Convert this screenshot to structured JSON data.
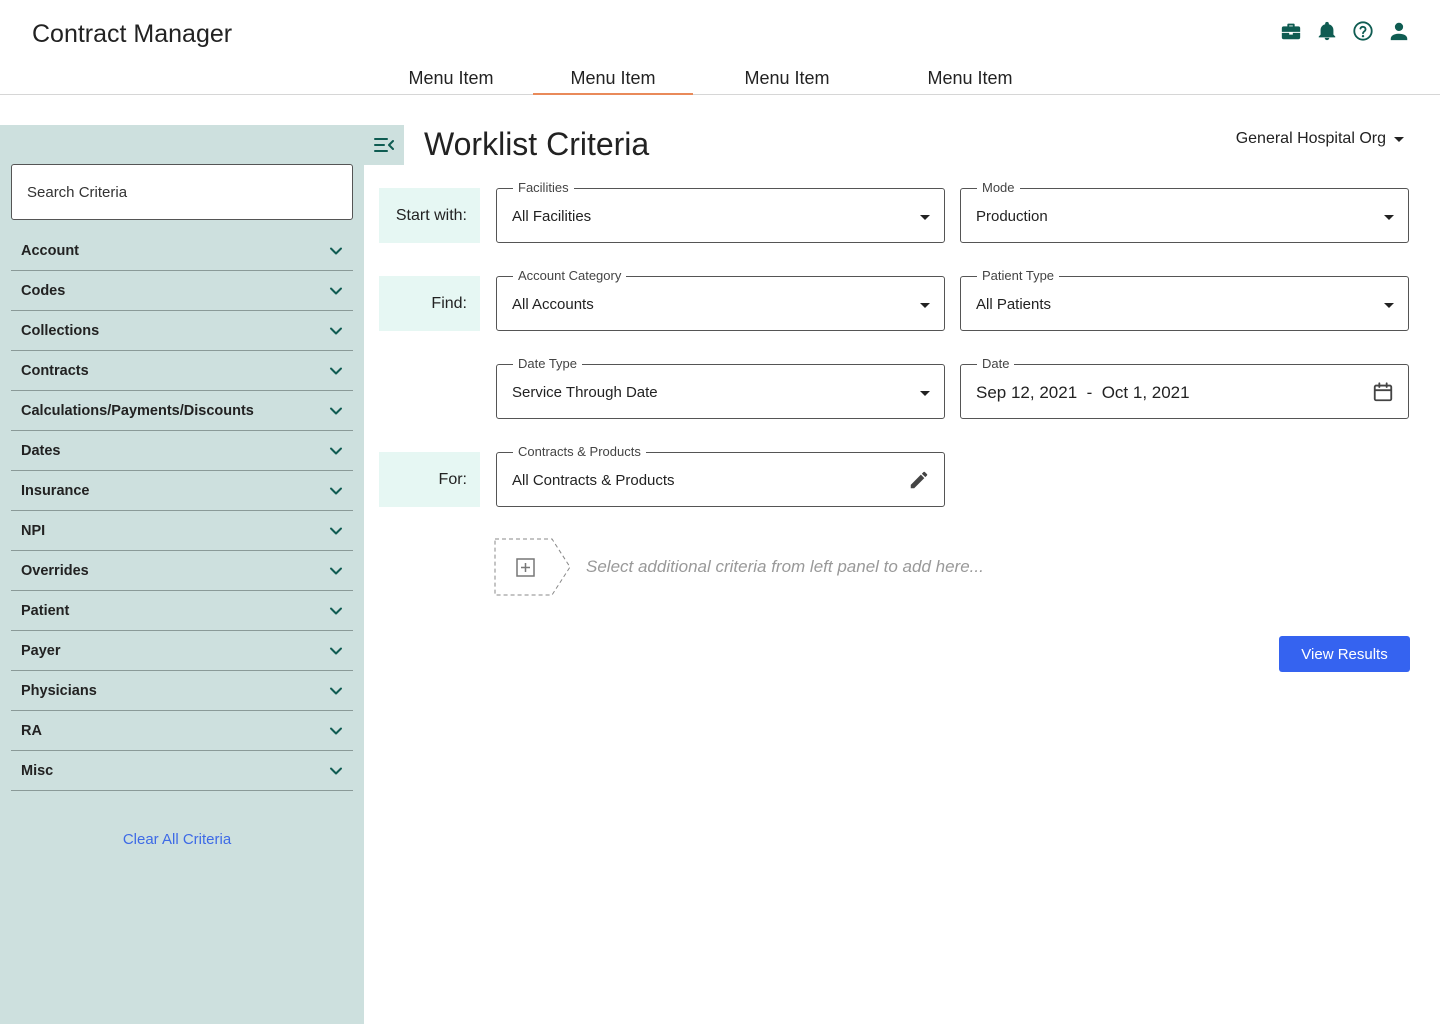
{
  "app": {
    "title": "Contract Manager"
  },
  "header_icons": [
    "briefcase-icon",
    "bell-icon",
    "help-icon",
    "user-icon"
  ],
  "nav": {
    "items": [
      {
        "label": "Menu Item",
        "active": false
      },
      {
        "label": "Menu Item",
        "active": true
      },
      {
        "label": "Menu Item",
        "active": false
      },
      {
        "label": "Menu Item",
        "active": false
      }
    ]
  },
  "sidebar": {
    "search_placeholder": "Search Criteria",
    "items": [
      "Account",
      "Codes",
      "Collections",
      "Contracts",
      "Calculations/Payments/Discounts",
      "Dates",
      "Insurance",
      "NPI",
      "Overrides",
      "Patient",
      "Payer",
      "Physicians",
      "RA",
      "Misc"
    ],
    "clear_label": "Clear All Criteria"
  },
  "main": {
    "title": "Worklist Criteria",
    "org": "General Hospital Org",
    "rows": {
      "start_label": "Start with:",
      "find_label": "Find:",
      "for_label": "For:"
    },
    "fields": {
      "facilities": {
        "label": "Facilities",
        "value": "All Facilities"
      },
      "mode": {
        "label": "Mode",
        "value": "Production"
      },
      "account_category": {
        "label": "Account Category",
        "value": "All Accounts"
      },
      "patient_type": {
        "label": "Patient Type",
        "value": "All Patients"
      },
      "date_type": {
        "label": "Date Type",
        "value": "Service Through Date"
      },
      "date": {
        "label": "Date",
        "value": "Sep 12, 2021  -  Oct 1, 2021"
      },
      "contracts": {
        "label": "Contracts & Products",
        "value": "All Contracts & Products"
      }
    },
    "add_hint": "Select additional criteria from left panel to add here...",
    "view_button": "View Results"
  },
  "colors": {
    "accent": "#3563f0",
    "nav_active": "#e98a5a",
    "sidebar_bg": "#cde0de",
    "label_bg": "#e6f7f3",
    "icon": "#0f5c52"
  }
}
